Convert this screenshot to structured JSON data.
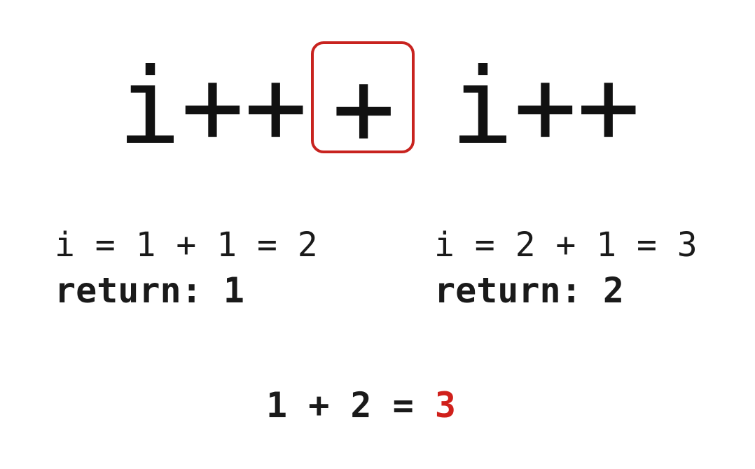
{
  "expression": {
    "left_operand": "i++",
    "operator": "+",
    "right_operand": "i++"
  },
  "left_step": {
    "assignment": "i = 1 + 1 = 2",
    "return": "return: 1"
  },
  "right_step": {
    "assignment": "i = 2 + 1 = 3",
    "return": "return: 2"
  },
  "result": {
    "equation": "1 + 2 = ",
    "value": "3"
  },
  "colors": {
    "highlight": "#c8231f",
    "result_value": "#d0201b",
    "text": "#111111"
  }
}
